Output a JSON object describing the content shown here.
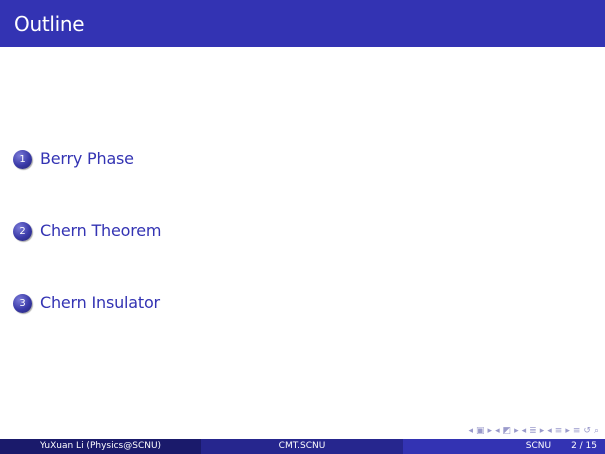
{
  "header": {
    "title": "Outline"
  },
  "outline": {
    "items": [
      {
        "number": "1",
        "label": "Berry Phase"
      },
      {
        "number": "2",
        "label": "Chern Theorem"
      },
      {
        "number": "3",
        "label": "Chern Insulator"
      }
    ]
  },
  "footer": {
    "author": "YuXuan Li  (Physics@SCNU)",
    "title": "CMT.SCNU",
    "institute": "SCNU",
    "page": "2 / 15"
  },
  "colors": {
    "header_bg": "#3333b3",
    "footer_left_bg": "#1a1a6b",
    "footer_mid_bg": "#26268e",
    "footer_right_bg": "#3333b3",
    "item_text": "#3333b3"
  },
  "nav_icons": [
    "nav-prev-arrow-icon",
    "nav-frame-icon",
    "nav-next-arrow-icon",
    "nav-prev-arrow-icon",
    "nav-subsection-icon",
    "nav-next-arrow-icon",
    "nav-prev-arrow-icon",
    "nav-section-icon",
    "nav-next-arrow-icon",
    "nav-prev-arrow-icon",
    "nav-document-icon",
    "nav-next-arrow-icon",
    "nav-align-icon",
    "nav-back-icon",
    "nav-search-icon"
  ]
}
